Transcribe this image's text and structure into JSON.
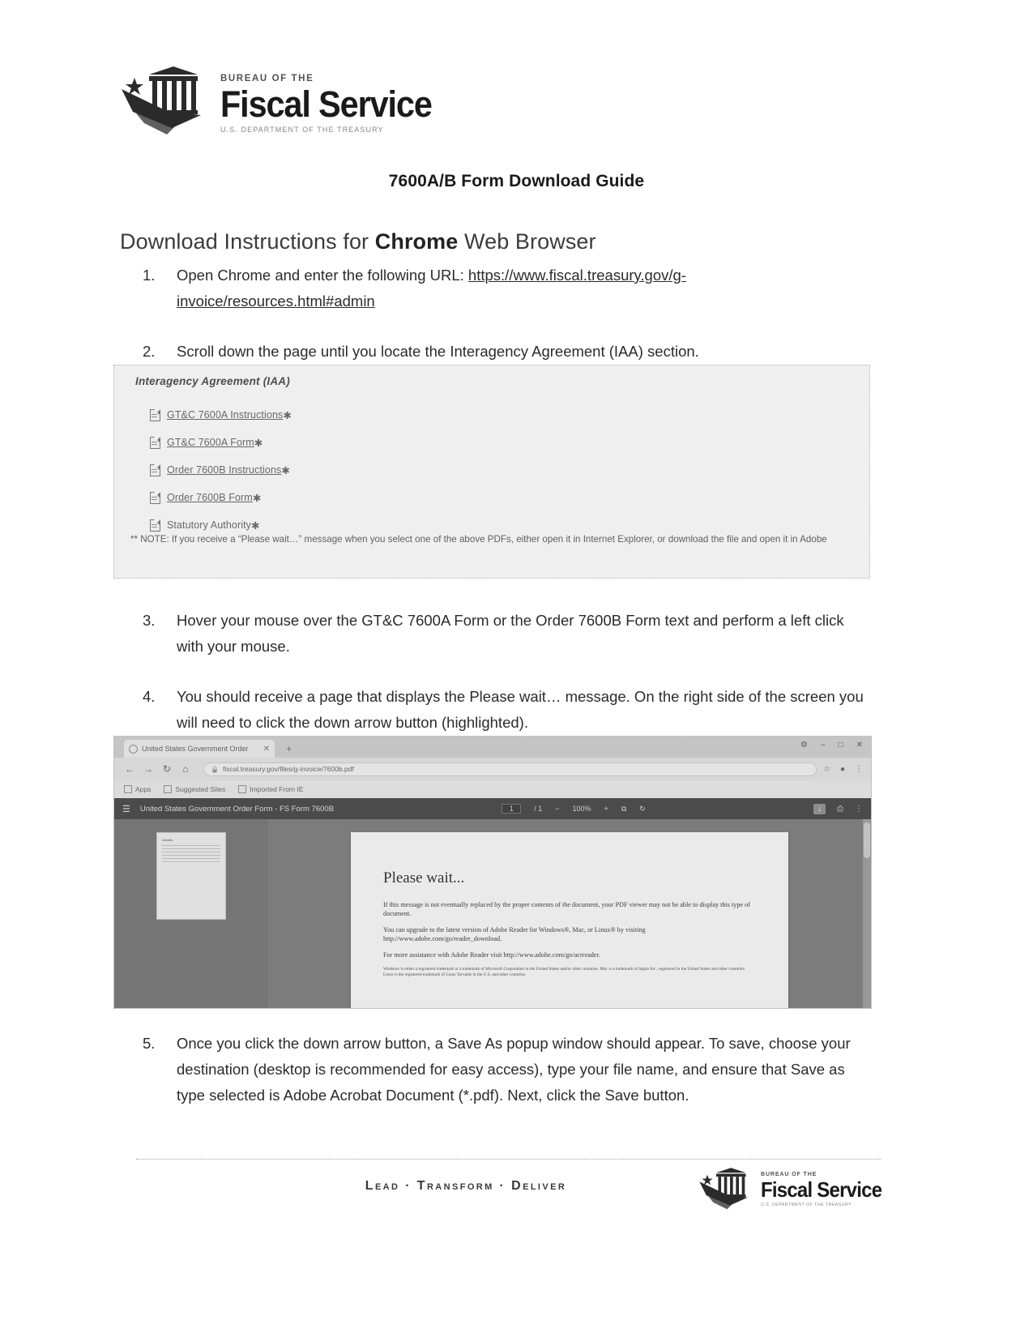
{
  "brand": {
    "bureau_line": "BUREAU OF THE",
    "name": "Fiscal Service",
    "department_line": "U.S. DEPARTMENT OF THE TREASURY"
  },
  "document": {
    "title": "7600A/B Form Download Guide"
  },
  "section": {
    "heading_prefix": "Download Instructions for ",
    "heading_emphasis": "Chrome",
    "heading_suffix": " Web Browser"
  },
  "steps": [
    {
      "number": "1.",
      "text_before_link": "Open Chrome and enter the following URL: ",
      "link": "https://www.fiscal.treasury.gov/g-invoice/resources.html#admin"
    },
    {
      "number": "2.",
      "text": "Scroll down the page until you locate the Interagency Agreement (IAA) section."
    },
    {
      "number": "3.",
      "text": "Hover your mouse over the GT&C 7600A Form or the Order 7600B Form text and perform a left click with your mouse."
    },
    {
      "number": "4.",
      "text": "You should receive a page that displays the Please wait… message. On the right side of the screen you will need to click the down arrow button (highlighted)."
    },
    {
      "number": "5.",
      "text": "Once you click the down arrow button, a Save As popup window should appear. To save, choose your destination (desktop is recommended for easy access), type your file name, and ensure that Save as type selected is Adobe Acrobat Document (*.pdf). Next, click the Save button."
    }
  ],
  "iaa_screenshot": {
    "heading": "Interagency Agreement (IAA)",
    "links": [
      {
        "label": "GT&C 7600A Instructions",
        "marker": "✱",
        "icon": "pdf-file-icon",
        "underlined": true
      },
      {
        "label": "GT&C 7600A Form",
        "marker": "✱",
        "icon": "pdf-file-icon",
        "underlined": true
      },
      {
        "label": "Order 7600B Instructions",
        "marker": "✱",
        "icon": "pdf-file-icon",
        "underlined": true
      },
      {
        "label": "Order 7600B Form",
        "marker": "✱",
        "icon": "pdf-file-icon",
        "underlined": true
      },
      {
        "label": "Statutory Authority",
        "marker": "✱",
        "icon": "pdf-file-icon",
        "underlined": false
      }
    ],
    "note": "** NOTE: If you receive a “Please wait…” message when you select one of the above PDFs, either open it in Internet Explorer, or download the file and open it in Adobe"
  },
  "browser_screenshot": {
    "tab": {
      "title": "United States Government Order",
      "close_label": "✕",
      "new_tab_label": "+"
    },
    "window_controls": {
      "minimize": "–",
      "maximize": "□",
      "close": "✕",
      "extension": "⚙"
    },
    "toolbar": {
      "back": "←",
      "forward": "→",
      "reload": "↻",
      "home": "⌂",
      "url": "fiscal.treasury.gov/files/g-invoice/7600b.pdf",
      "lock_icon": "lock-icon",
      "star": "☆",
      "profile": "●",
      "menu": "⋮"
    },
    "bookmarks": [
      {
        "label": "Apps"
      },
      {
        "label": "Suggested Sites"
      },
      {
        "label": "Imported From IE"
      }
    ],
    "pdf_toolbar": {
      "menu_icon": "hamburger-icon",
      "document_title": "United States Government Order Form - FS Form 7600B",
      "page_current": "1",
      "page_total": "/ 1",
      "zoom_out": "−",
      "zoom_level": "100%",
      "zoom_in": "+",
      "fit_icon": "⧉",
      "rotate_icon": "↻",
      "download_icon": "↓",
      "print_icon": "⎙",
      "more_icon": "⋮"
    },
    "thumbnail": {
      "title": "Details",
      "lines": 6
    },
    "page_content": {
      "heading": "Please wait...",
      "paragraph_1": "If this message is not eventually replaced by the proper contents of the document, your PDF viewer may not be able to display this type of document.",
      "paragraph_2": "You can upgrade to the latest version of Adobe Reader for Windows®, Mac, or Linux® by visiting  http://www.adobe.com/go/reader_download.",
      "paragraph_3": "For more assistance with Adobe Reader visit  http://www.adobe.com/go/acrreader.",
      "fine_print": "Windows is either a registered trademark or a trademark of Microsoft Corporation in the United States and/or other countries. Mac is a trademark of Apple Inc., registered in the United States and other countries. Linux is the registered trademark of Linus Torvalds in the U.S. and other countries."
    }
  },
  "footer": {
    "tagline": "Lead · Transform · Deliver"
  }
}
